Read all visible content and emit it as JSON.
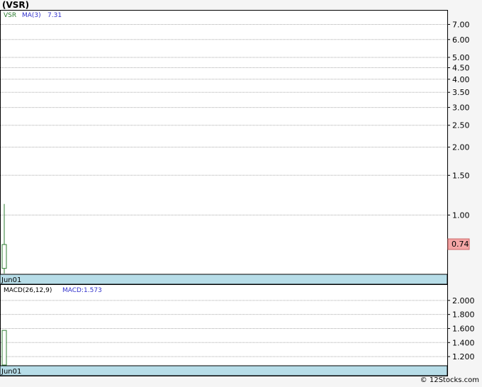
{
  "title": "(VSR)",
  "footer": "© 12Stocks.com",
  "colors": {
    "candle": "#2e7d32",
    "ma_label": "#3333cc",
    "date_band": "#b7dde8",
    "last_price_bg": "#f4a6a6",
    "grid": "#aaaaaa"
  },
  "chart_data": [
    {
      "type": "line",
      "panel": "price",
      "scale": "log",
      "legend": {
        "symbol": "VSR",
        "ma": "MA(3)",
        "ma_value": "7.31"
      },
      "yticks": [
        0.74,
        1.0,
        1.5,
        2.0,
        2.5,
        3.0,
        3.5,
        4.0,
        4.5,
        5.0,
        6.0,
        7.0
      ],
      "ytick_labels": [
        "1.00",
        "1.50",
        "2.00",
        "2.50",
        "3.00",
        "3.50",
        "4.00",
        "4.50",
        "5.00",
        "6.00",
        "7.00"
      ],
      "ylim": [
        0.55,
        8.0
      ],
      "grid": true,
      "candles": [
        {
          "x": "Jun01",
          "open": 0.74,
          "high": 1.12,
          "low": 0.55,
          "close": 0.58
        }
      ],
      "last_price_label": "0.74",
      "x_label": "Jun01"
    },
    {
      "type": "bar",
      "panel": "macd",
      "legend": {
        "name": "MACD(26,12,9)",
        "value_label": "MACD:1.573"
      },
      "ytick_labels": [
        "1.200",
        "1.400",
        "1.600",
        "1.800",
        "2.000"
      ],
      "ylim": [
        1.08,
        2.2
      ],
      "grid": true,
      "bars": [
        {
          "x": "Jun01",
          "value": 1.573
        }
      ],
      "x_label": "Jun01"
    }
  ]
}
